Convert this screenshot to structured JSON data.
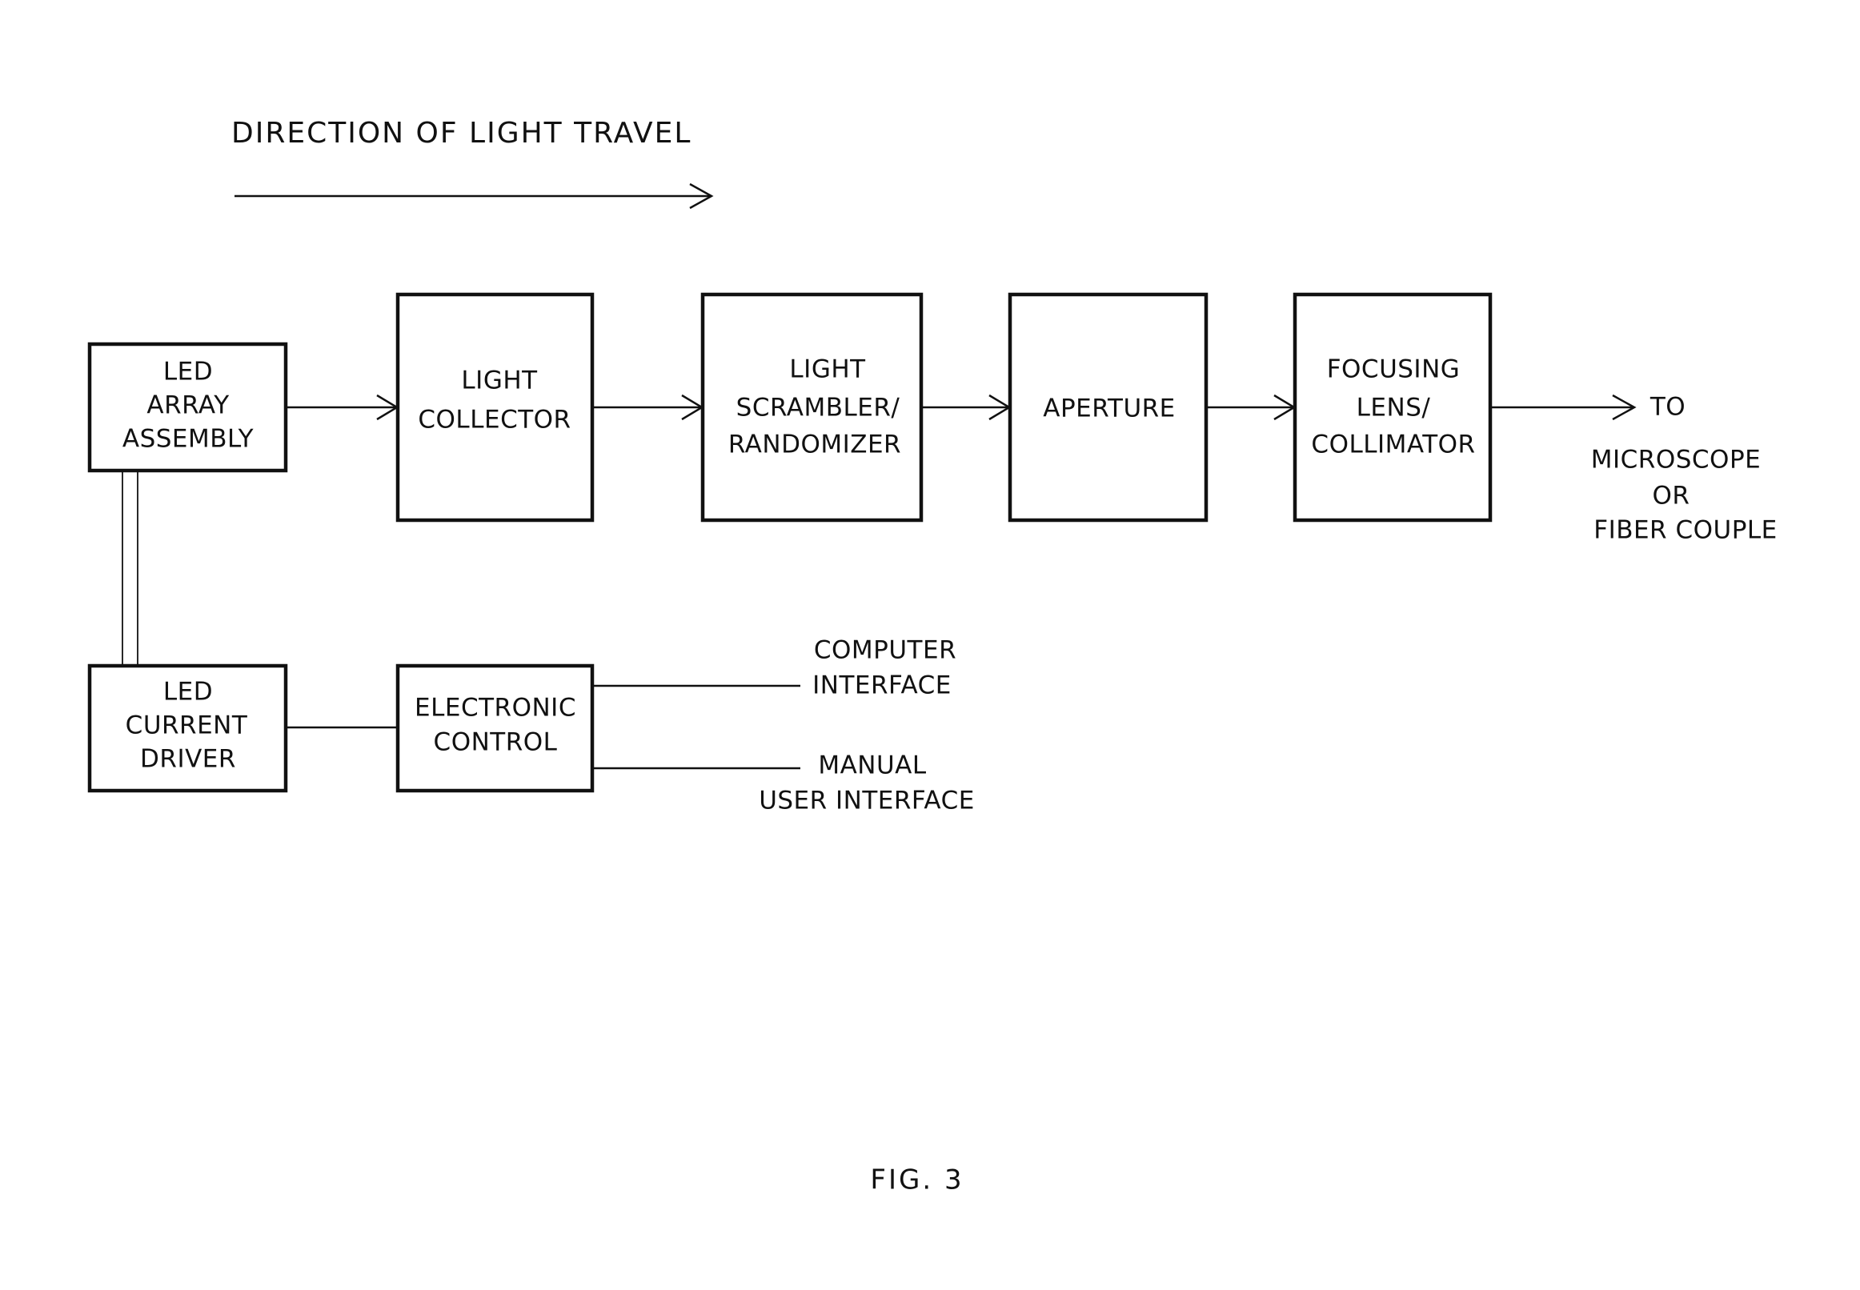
{
  "title": "DIRECTION OF LIGHT TRAVEL",
  "caption": "FIG. 3",
  "blocks": {
    "led_array": [
      "LED",
      "ARRAY",
      "ASSEMBLY"
    ],
    "light_collector": [
      "LIGHT",
      "COLLECTOR"
    ],
    "scrambler": [
      "LIGHT",
      "SCRAMBLER/",
      "RANDOMIZER"
    ],
    "aperture": [
      "APERTURE"
    ],
    "focusing": [
      "FOCUSING",
      "LENS/",
      "COLLIMATOR"
    ],
    "led_driver": [
      "LED",
      "CURRENT",
      "DRIVER"
    ],
    "electronic_control": [
      "ELECTRONIC",
      "CONTROL"
    ]
  },
  "output": {
    "to": "TO",
    "destination": [
      "MICROSCOPE",
      "OR",
      "FIBER COUPLE"
    ]
  },
  "interfaces": {
    "computer": [
      "COMPUTER",
      "INTERFACE"
    ],
    "manual": [
      "MANUAL",
      "USER INTERFACE"
    ]
  }
}
